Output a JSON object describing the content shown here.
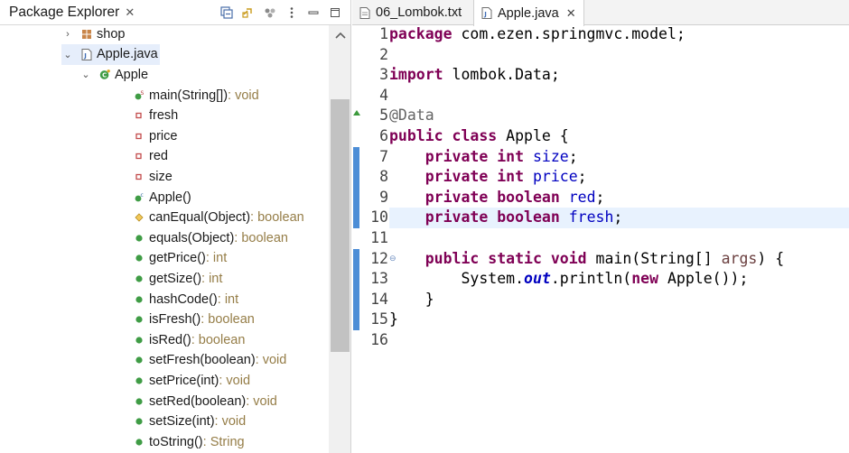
{
  "explorer": {
    "title": "Package Explorer",
    "close": "✕",
    "tree": [
      {
        "label": "shop",
        "kind": "package",
        "indent": 1,
        "arrow": "›",
        "selected": false
      },
      {
        "label": "Apple.java",
        "kind": "file",
        "indent": 1,
        "arrow": "⌄",
        "selected": true
      },
      {
        "label": "Apple",
        "kind": "class",
        "indent": 2,
        "arrow": "⌄",
        "selected": false
      },
      {
        "label": "main(String[])",
        "type": " : void",
        "kind": "method-static"
      },
      {
        "label": "fresh",
        "kind": "field"
      },
      {
        "label": "price",
        "kind": "field"
      },
      {
        "label": "red",
        "kind": "field"
      },
      {
        "label": "size",
        "kind": "field"
      },
      {
        "label": "Apple()",
        "kind": "constructor"
      },
      {
        "label": "canEqual(Object)",
        "type": " : boolean",
        "kind": "method-protected"
      },
      {
        "label": "equals(Object)",
        "type": " : boolean",
        "kind": "method-public"
      },
      {
        "label": "getPrice()",
        "type": " : int",
        "kind": "method-public"
      },
      {
        "label": "getSize()",
        "type": " : int",
        "kind": "method-public"
      },
      {
        "label": "hashCode()",
        "type": " : int",
        "kind": "method-public"
      },
      {
        "label": "isFresh()",
        "type": " : boolean",
        "kind": "method-public"
      },
      {
        "label": "isRed()",
        "type": " : boolean",
        "kind": "method-public"
      },
      {
        "label": "setFresh(boolean)",
        "type": " : void",
        "kind": "method-public"
      },
      {
        "label": "setPrice(int)",
        "type": " : void",
        "kind": "method-public"
      },
      {
        "label": "setRed(boolean)",
        "type": " : void",
        "kind": "method-public"
      },
      {
        "label": "setSize(int)",
        "type": " : void",
        "kind": "method-public"
      },
      {
        "label": "toString()",
        "type": " : String",
        "kind": "method-public"
      }
    ]
  },
  "editor": {
    "tabs": [
      {
        "label": "06_Lombok.txt",
        "active": false
      },
      {
        "label": "Apple.java",
        "active": true,
        "close": "✕"
      }
    ],
    "current_line": 10,
    "lines": [
      [
        [
          "kw",
          "package"
        ],
        [
          "t",
          " com.ezen.springmvc.model;"
        ]
      ],
      [],
      [
        [
          "kw",
          "import"
        ],
        [
          "t",
          " lombok.Data;"
        ]
      ],
      [],
      [
        [
          "ann",
          "@Data"
        ]
      ],
      [
        [
          "kw",
          "public"
        ],
        [
          "t",
          " "
        ],
        [
          "kw",
          "class"
        ],
        [
          "t",
          " Apple {"
        ]
      ],
      [
        [
          "t",
          "    "
        ],
        [
          "kw",
          "private"
        ],
        [
          "t",
          " "
        ],
        [
          "kw",
          "int"
        ],
        [
          "t",
          " "
        ],
        [
          "fld",
          "size"
        ],
        [
          "t",
          ";"
        ]
      ],
      [
        [
          "t",
          "    "
        ],
        [
          "kw",
          "private"
        ],
        [
          "t",
          " "
        ],
        [
          "kw",
          "int"
        ],
        [
          "t",
          " "
        ],
        [
          "fld",
          "price"
        ],
        [
          "t",
          ";"
        ]
      ],
      [
        [
          "t",
          "    "
        ],
        [
          "kw",
          "private"
        ],
        [
          "t",
          " "
        ],
        [
          "kw",
          "boolean"
        ],
        [
          "t",
          " "
        ],
        [
          "fld",
          "red"
        ],
        [
          "t",
          ";"
        ]
      ],
      [
        [
          "t",
          "    "
        ],
        [
          "kw",
          "private"
        ],
        [
          "t",
          " "
        ],
        [
          "kw",
          "boolean"
        ],
        [
          "t",
          " "
        ],
        [
          "fld",
          "fresh"
        ],
        [
          "t",
          ";"
        ]
      ],
      [],
      [
        [
          "t",
          "    "
        ],
        [
          "kw",
          "public"
        ],
        [
          "t",
          " "
        ],
        [
          "kw",
          "static"
        ],
        [
          "t",
          " "
        ],
        [
          "kw",
          "void"
        ],
        [
          "t",
          " main(String[] "
        ],
        [
          "par",
          "args"
        ],
        [
          "t",
          ") {"
        ]
      ],
      [
        [
          "t",
          "        System."
        ],
        [
          "stat",
          "out"
        ],
        [
          "t",
          ".println("
        ],
        [
          "kw",
          "new"
        ],
        [
          "t",
          " Apple());"
        ]
      ],
      [
        [
          "t",
          "    }"
        ]
      ],
      [
        [
          "t",
          "}"
        ]
      ],
      []
    ]
  },
  "colors": {
    "keyword": "#7f0055",
    "field": "#0000c0",
    "type_hint": "#957d47",
    "current_line": "#e8f2fe",
    "ruler": "#4c8dd6"
  }
}
